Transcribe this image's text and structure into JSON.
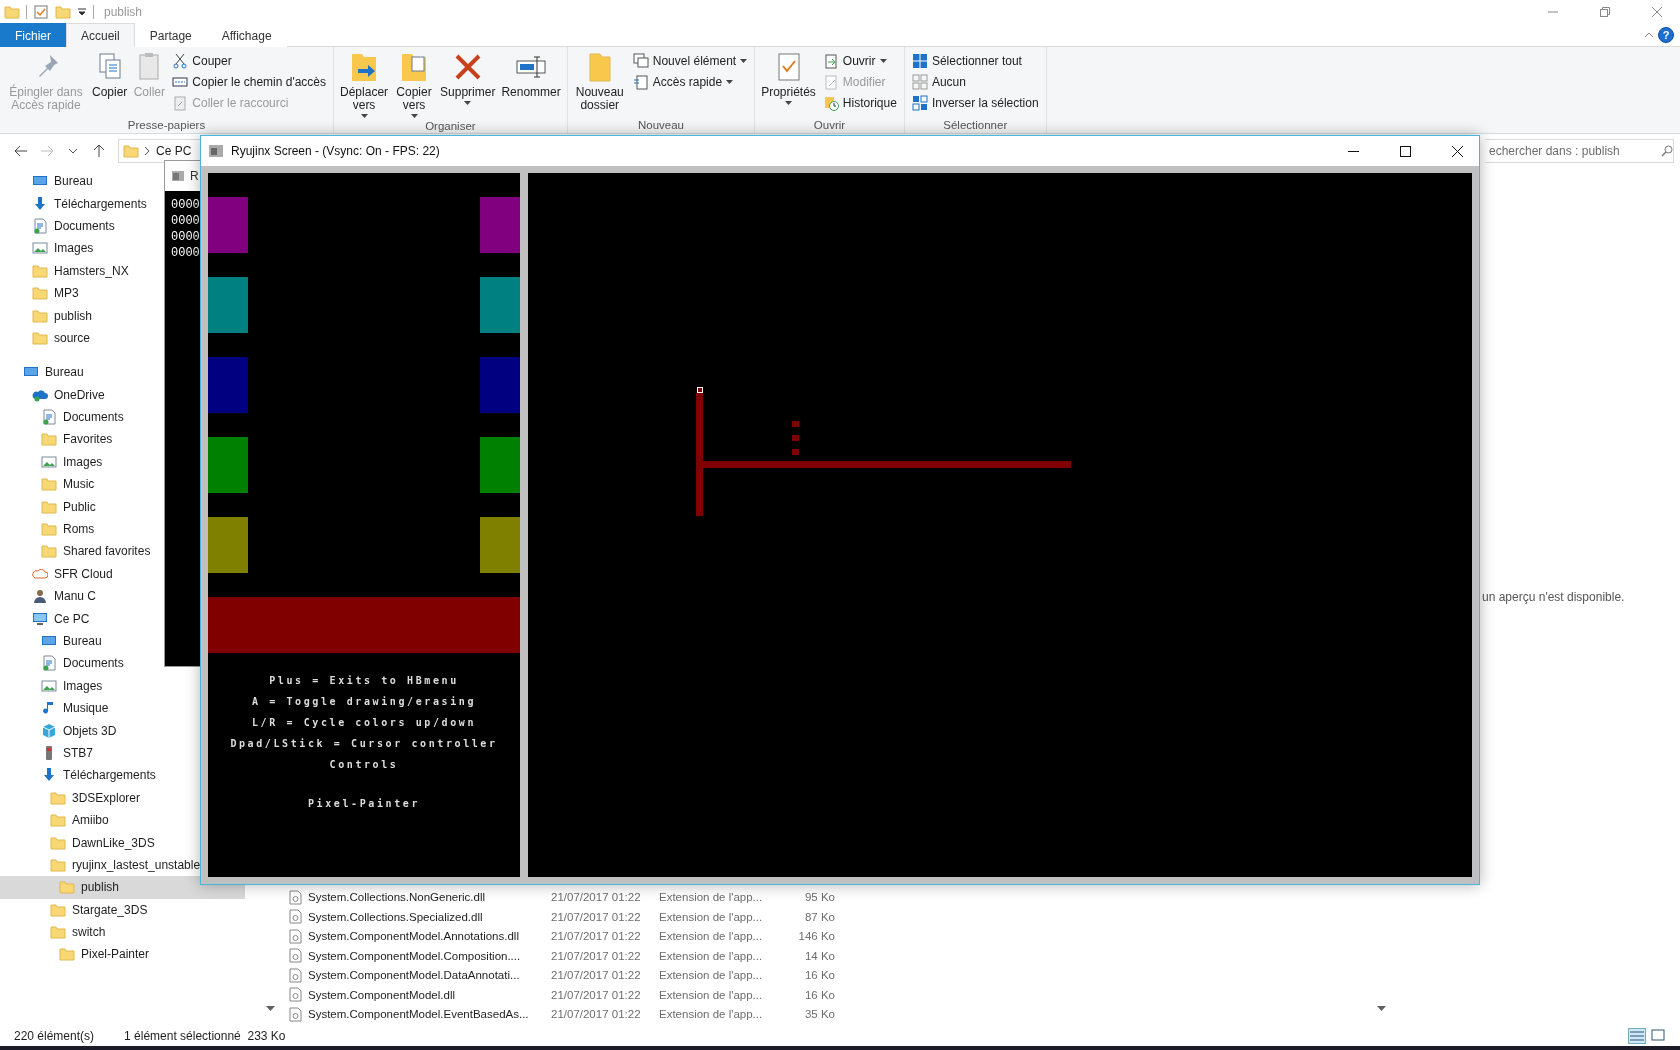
{
  "title_bar": {
    "title": "publish"
  },
  "ribbon": {
    "tabs": [
      {
        "label": "Fichier",
        "kind": "file",
        "selected": false
      },
      {
        "label": "Accueil",
        "kind": "tab",
        "selected": true
      },
      {
        "label": "Partage",
        "kind": "tab",
        "selected": false
      },
      {
        "label": "Affichage",
        "kind": "tab",
        "selected": false
      }
    ],
    "help": "?",
    "groups": [
      {
        "label": "Presse-papiers",
        "items": [
          {
            "kind": "large",
            "label": "Épingler dans Accès rapide",
            "disabled": true,
            "dropdown": false
          },
          {
            "kind": "large",
            "label": "Copier",
            "disabled": false,
            "dropdown": false
          },
          {
            "kind": "large",
            "label": "Coller",
            "disabled": true,
            "dropdown": false
          },
          {
            "kind": "small",
            "label": "Couper",
            "disabled": false,
            "dropdown": false
          },
          {
            "kind": "small",
            "label": "Copier le chemin d'accès",
            "disabled": false,
            "dropdown": false
          },
          {
            "kind": "small",
            "label": "Coller le raccourci",
            "disabled": true,
            "dropdown": false
          }
        ]
      },
      {
        "label": "Organiser",
        "items": [
          {
            "kind": "large",
            "label": "Déplacer vers",
            "disabled": false,
            "dropdown": true
          },
          {
            "kind": "large",
            "label": "Copier vers",
            "disabled": false,
            "dropdown": true
          },
          {
            "kind": "large",
            "label": "Supprimer",
            "disabled": false,
            "dropdown": true
          },
          {
            "kind": "large",
            "label": "Renommer",
            "disabled": false,
            "dropdown": false
          }
        ]
      },
      {
        "label": "Nouveau",
        "items": [
          {
            "kind": "large",
            "label": "Nouveau dossier",
            "disabled": false,
            "dropdown": false
          },
          {
            "kind": "small",
            "label": "Nouvel élément",
            "disabled": false,
            "dropdown": true
          },
          {
            "kind": "small",
            "label": "Accès rapide",
            "disabled": false,
            "dropdown": true
          }
        ]
      },
      {
        "label": "Ouvrir",
        "items": [
          {
            "kind": "large",
            "label": "Propriétés",
            "disabled": false,
            "dropdown": true
          },
          {
            "kind": "small",
            "label": "Ouvrir",
            "disabled": false,
            "dropdown": true
          },
          {
            "kind": "small",
            "label": "Modifier",
            "disabled": true,
            "dropdown": false
          },
          {
            "kind": "small",
            "label": "Historique",
            "disabled": false,
            "dropdown": false
          }
        ]
      },
      {
        "label": "Sélectionner",
        "items": [
          {
            "kind": "small",
            "label": "Sélectionner tout",
            "disabled": false,
            "dropdown": false
          },
          {
            "kind": "small",
            "label": "Aucun",
            "disabled": false,
            "dropdown": false
          },
          {
            "kind": "small",
            "label": "Inverser la sélection",
            "disabled": false,
            "dropdown": false
          }
        ]
      }
    ]
  },
  "address_bar": {
    "path": "Ce PC"
  },
  "search": {
    "placeholder": "echercher dans : publish"
  },
  "sidebar": {
    "quick_access": [
      {
        "label": "Bureau",
        "kind": "desktop",
        "selected": false
      },
      {
        "label": "Téléchargements",
        "kind": "download",
        "selected": false
      },
      {
        "label": "Documents",
        "kind": "documents",
        "selected": false
      },
      {
        "label": "Images",
        "kind": "images",
        "selected": false
      },
      {
        "label": "Hamsters_NX",
        "kind": "folder",
        "selected": false
      },
      {
        "label": "MP3",
        "kind": "folder",
        "selected": false
      },
      {
        "label": "publish",
        "kind": "folder",
        "selected": false
      },
      {
        "label": "source",
        "kind": "folder",
        "selected": false
      }
    ],
    "tree": [
      {
        "label": "Bureau",
        "kind": "desktop",
        "selected": false,
        "children": [
          {
            "label": "OneDrive",
            "kind": "onedrive",
            "selected": false,
            "children": [
              {
                "label": "Documents",
                "kind": "documents",
                "selected": false
              },
              {
                "label": "Favorites",
                "kind": "folder",
                "selected": false
              },
              {
                "label": "Images",
                "kind": "images",
                "selected": false
              },
              {
                "label": "Music",
                "kind": "folder",
                "selected": false
              },
              {
                "label": "Public",
                "kind": "folder",
                "selected": false
              },
              {
                "label": "Roms",
                "kind": "folder",
                "selected": false
              },
              {
                "label": "Shared favorites",
                "kind": "folder",
                "selected": false
              }
            ]
          },
          {
            "label": "SFR Cloud",
            "kind": "cloud",
            "selected": false
          },
          {
            "label": "Manu C",
            "kind": "user",
            "selected": false
          },
          {
            "label": "Ce PC",
            "kind": "pc",
            "selected": false,
            "children": [
              {
                "label": "Bureau",
                "kind": "desktop",
                "selected": false
              },
              {
                "label": "Documents",
                "kind": "documents",
                "selected": false
              },
              {
                "label": "Images",
                "kind": "images",
                "selected": false
              },
              {
                "label": "Musique",
                "kind": "music",
                "selected": false
              },
              {
                "label": "Objets 3D",
                "kind": "cube",
                "selected": false
              },
              {
                "label": "STB7",
                "kind": "device",
                "selected": false
              },
              {
                "label": "Téléchargements",
                "kind": "download",
                "selected": false,
                "children": [
                  {
                    "label": "3DSExplorer",
                    "kind": "folder",
                    "selected": false
                  },
                  {
                    "label": "Amiibo",
                    "kind": "folder",
                    "selected": false
                  },
                  {
                    "label": "DawnLike_3DS",
                    "kind": "folder",
                    "selected": false
                  },
                  {
                    "label": "ryujinx_lastest_unstable",
                    "kind": "folder",
                    "selected": false,
                    "children": [
                      {
                        "label": "publish",
                        "kind": "folder",
                        "selected": true
                      }
                    ]
                  },
                  {
                    "label": "Stargate_3DS",
                    "kind": "folder",
                    "selected": false
                  },
                  {
                    "label": "switch",
                    "kind": "folder",
                    "selected": false,
                    "children": [
                      {
                        "label": "Pixel-Painter",
                        "kind": "folder",
                        "selected": false
                      }
                    ]
                  }
                ]
              }
            ]
          }
        ]
      }
    ]
  },
  "files": [
    {
      "name": "System.Collections.NonGeneric.dll",
      "date": "21/07/2017 01:22",
      "type": "Extension de l'app...",
      "size": "95 Ko"
    },
    {
      "name": "System.Collections.Specialized.dll",
      "date": "21/07/2017 01:22",
      "type": "Extension de l'app...",
      "size": "87 Ko"
    },
    {
      "name": "System.ComponentModel.Annotations.dll",
      "date": "21/07/2017 01:22",
      "type": "Extension de l'app...",
      "size": "146 Ko"
    },
    {
      "name": "System.ComponentModel.Composition....",
      "date": "21/07/2017 01:22",
      "type": "Extension de l'app...",
      "size": "14 Ko"
    },
    {
      "name": "System.ComponentModel.DataAnnotati...",
      "date": "21/07/2017 01:22",
      "type": "Extension de l'app...",
      "size": "16 Ko"
    },
    {
      "name": "System.ComponentModel.dll",
      "date": "21/07/2017 01:22",
      "type": "Extension de l'app...",
      "size": "16 Ko"
    },
    {
      "name": "System.ComponentModel.EventBasedAs...",
      "date": "21/07/2017 01:22",
      "type": "Extension de l'app...",
      "size": "35 Ko"
    }
  ],
  "preview": {
    "message": "un aperçu n'est disponible."
  },
  "status_bar": {
    "count": "220 élément(s)",
    "selection": "1 élément sélectionné  233 Ko"
  },
  "console_window": {
    "title": "R",
    "lines": [
      "0000",
      "0000",
      "0000",
      "0000"
    ]
  },
  "emulator_window": {
    "title": "Ryujinx Screen - (Vsync: On - FPS: 22)",
    "game": {
      "left_swatches": [
        {
          "color": "#800080"
        },
        {
          "color": "#008080"
        },
        {
          "color": "#000080"
        },
        {
          "color": "#008000"
        },
        {
          "color": "#808000"
        }
      ],
      "right_swatches": [
        {
          "color": "#800080"
        },
        {
          "color": "#008080"
        },
        {
          "color": "#000080"
        },
        {
          "color": "#008000"
        },
        {
          "color": "#808000"
        }
      ],
      "selected_color_bar": {
        "color": "#800000"
      },
      "controls": [
        "Plus = Exits to HBmenu",
        "A = Toggle drawing/erasing",
        "L/R = Cycle colors up/down",
        "Dpad/LStick = Cursor controller",
        "Controls"
      ],
      "title": "Pixel-Painter"
    }
  }
}
